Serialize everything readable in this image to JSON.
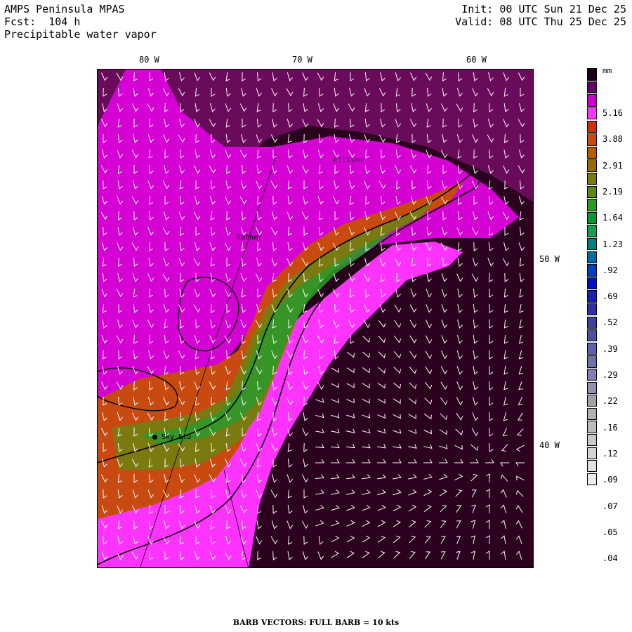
{
  "header": {
    "title": "AMPS Peninsula MPAS",
    "forecast": "Fcst:  104 h",
    "field": "Precipitable water vapor",
    "init": "Init: 00 UTC Sun 21 Dec 25",
    "valid": "Valid: 08 UTC Thu 25 Dec 25"
  },
  "map": {
    "longitude_labels": [
      "80 W",
      "70 W",
      "60 W"
    ],
    "latitude_labels": [
      "50 W",
      "40 W"
    ],
    "stations": [
      {
        "name": "Sky Blu",
        "marker": "filled-dot"
      },
      {
        "name": "Rother",
        "marker": "none"
      },
      {
        "name": "Ellison",
        "marker": "none"
      }
    ],
    "station_label_colors": {
      "Sky Blu": "#000000",
      "Rother": "#000000",
      "Ellison": "#333333"
    },
    "colors": {
      "ocean_dark": "#2a001e",
      "magenta": "#e000e0",
      "pink": "#ff33ff",
      "purple": "#7a1a7a",
      "orange": "#c84a10",
      "olive": "#7a7a10",
      "green": "#2a9a2a"
    }
  },
  "legend": {
    "units": "mm",
    "colors": [
      "#1a0018",
      "#660066",
      "#cc00cc",
      "#ff33ff",
      "#cc3300",
      "#c84a10",
      "#b85c00",
      "#9a6a00",
      "#7a7a10",
      "#5a8a10",
      "#2a9a20",
      "#009a30",
      "#10a050",
      "#008080",
      "#006aa0",
      "#0040c0",
      "#0010c0",
      "#1a20b0",
      "#3030a0",
      "#40409a",
      "#5050a0",
      "#6060a8",
      "#7070a8",
      "#8080b0",
      "#9090b0",
      "#a0a0a8",
      "#b0b0b0",
      "#bcbcbc",
      "#c8c8c8",
      "#d4d4d4",
      "#e0e0e0",
      "#ececec"
    ],
    "labels": [
      "5.16",
      "3.88",
      "2.91",
      "2.19",
      "1.64",
      "1.23",
      ".92",
      ".69",
      ".52",
      ".39",
      ".29",
      ".22",
      ".16",
      ".12",
      ".09",
      ".07",
      ".05",
      ".04"
    ]
  },
  "footer": "BARB VECTORS:  FULL BARB = 10 kts"
}
